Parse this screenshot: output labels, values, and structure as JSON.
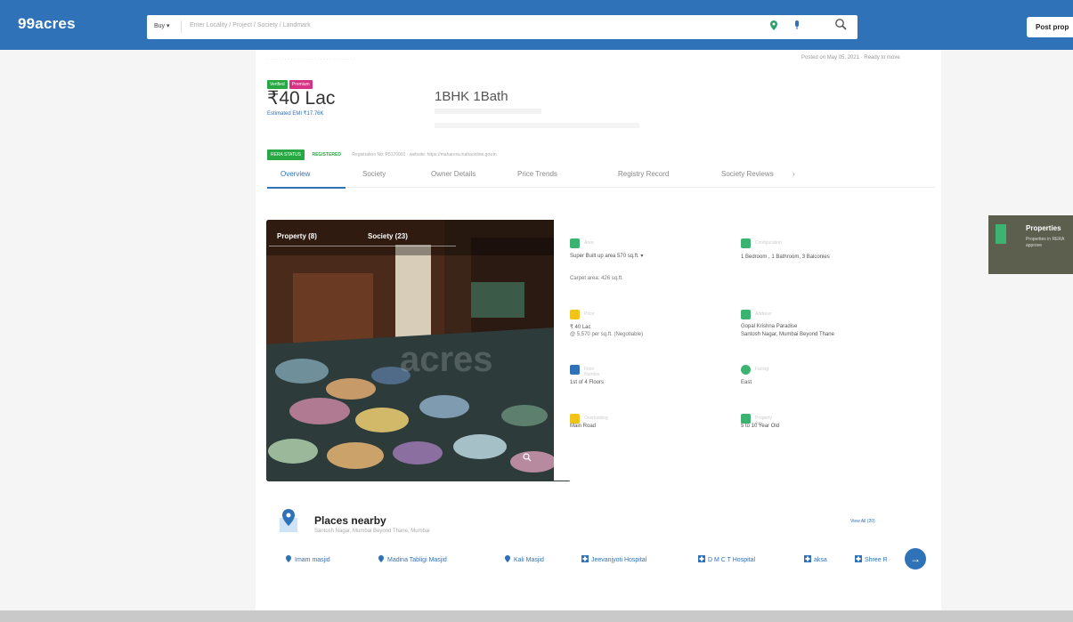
{
  "header": {
    "logo": "99acres",
    "buy_label": "Buy ▾",
    "search_placeholder": "Enter Locality / Project / Society / Landmark",
    "post_button": "Post prop"
  },
  "listing": {
    "badges": [
      "Verified",
      "Premium"
    ],
    "posted": "Posted on May 05, 2021 · Ready to move",
    "price": "₹40 Lac",
    "emi": "Estimated EMI ₹17.76K",
    "configuration": "1BHK 1Bath",
    "rera_status": "RERA STATUS",
    "rera_registered": "REGISTERED",
    "rera_no": "Registration No: P5170001 · website: https://maharera.mahaonline.gov.in"
  },
  "tabs": [
    "Overview",
    "Society",
    "Owner Details",
    "Price Trends",
    "Registry Record",
    "Society Reviews"
  ],
  "gallery": {
    "tabs": [
      "Property (8)",
      "Society (23)"
    ],
    "watermark": "acres"
  },
  "details": [
    {
      "label": "Area",
      "value": "Super Built up area 570  sq.ft. ▾",
      "value2": "Carpet area: 426 sq.ft.",
      "icon_color": "#3cb371"
    },
    {
      "label": "Configuration",
      "value": "1 Bedroom , 1 Bathroom, 3 Balconies",
      "value2": "",
      "icon_color": "#3cb371"
    },
    {
      "label": "Price",
      "value": "₹ 40 Lac",
      "value2": "@ 5,570 per sq.ft. (Negotiable)",
      "icon_color": "#f0c419"
    },
    {
      "label": "Address",
      "value": "Gopal Krishna Paradise",
      "value2": "Santosh Nagar, Mumbai Beyond Thane",
      "icon_color": "#3cb371"
    },
    {
      "label": "Floor Number",
      "value": "1st of 4 Floors",
      "value2": "",
      "icon_color": "#2f72b8"
    },
    {
      "label": "Facing",
      "value": "East",
      "value2": "",
      "icon_color": "#3cb371"
    },
    {
      "label": "Overlooking",
      "value": "Main Road",
      "value2": "",
      "icon_color": "#f0c419"
    },
    {
      "label": "Property Age",
      "value": "5 to 10 Year Old",
      "value2": "",
      "icon_color": "#3cb371"
    }
  ],
  "places": {
    "title": "Places nearby",
    "subtitle": "Santosh Nagar, Mumbai Beyond Thane, Mumbai",
    "view_all": "View All (20)",
    "items": [
      {
        "name": "Imam masjid",
        "icon": "pin-icon"
      },
      {
        "name": "Madina Tabligi Masjid",
        "icon": "pin-icon"
      },
      {
        "name": "Kali Masjid",
        "icon": "pin-icon"
      },
      {
        "name": "Jeevanjyoti Hospital",
        "icon": "hospital-icon"
      },
      {
        "name": "D M C T Hospital",
        "icon": "hospital-icon"
      },
      {
        "name": "aksa",
        "icon": "hospital-icon"
      },
      {
        "name": "Shree R",
        "icon": "hospital-icon"
      }
    ]
  },
  "side_banner": {
    "title": "Properties",
    "subtitle": "Properties in RERA approve"
  }
}
